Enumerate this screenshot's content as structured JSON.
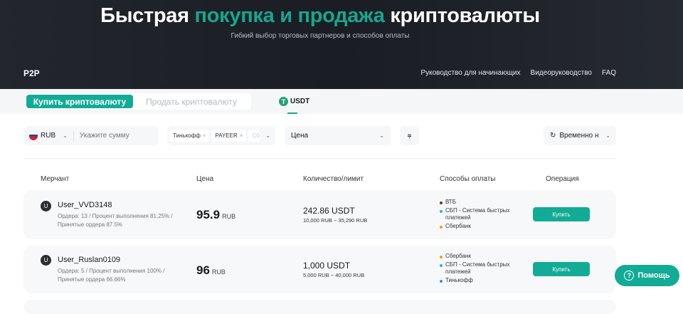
{
  "hero": {
    "title_a": "Быстрая ",
    "title_b": "покупка и продажа",
    "title_c": " криптовалюты",
    "subtitle": "Гибкий выбор торговых партнеров и способов оплаты",
    "brand": "P2P",
    "nav": [
      "Руководство для начинающих",
      "Видеоруководство",
      "FAQ"
    ]
  },
  "tabs": {
    "buy": "Купить криптовалюту",
    "sell": "Продать криптовалюту",
    "coin": "USDT",
    "coin_icon": "T"
  },
  "filters": {
    "currency": "RUB",
    "currency_flag": "RUB",
    "amount_placeholder": "Укажите сумму",
    "chips": [
      "Тинькофф",
      "PAYEER",
      "Сб"
    ],
    "sort": "Цена",
    "status": "Временно н"
  },
  "headers": [
    "Мерчант",
    "Цена",
    "Количество/лимит",
    "Способы оплаты",
    "Операция"
  ],
  "rows": [
    {
      "avatar": "U",
      "name": "User_VVD3148",
      "stats": "Ордера: 13 / Процент выполнения 81.25% / Принятые ордера 87.5%",
      "price": "95.9",
      "currency": "RUB",
      "qty": "242.86 USDT",
      "limit": "10,000 RUB ~ 35,290 RUB",
      "payments": [
        {
          "name": "ВТБ",
          "color": "#6b3a1a"
        },
        {
          "name": "СБП - Система быстрых платежей",
          "color": "#1fb6d6"
        },
        {
          "name": "Сбербанк",
          "color": "#f59a1b"
        }
      ],
      "action": "Купить"
    },
    {
      "avatar": "U",
      "name": "User_Ruslan0109",
      "stats": "Ордера: 5 / Процент выполнения 100% / Принятые ордера 66.66%",
      "price": "96",
      "currency": "RUB",
      "qty": "1,000 USDT",
      "limit": "5,000 RUB ~ 40,000 RUB",
      "payments": [
        {
          "name": "Сбербанк",
          "color": "#f59a1b"
        },
        {
          "name": "СБП - Система быстрых платежей",
          "color": "#1fb6d6"
        },
        {
          "name": "Тинькофф",
          "color": "#1e9be8"
        }
      ],
      "action": "Купить"
    }
  ],
  "help": {
    "label": "Помощь",
    "icon": "?"
  }
}
